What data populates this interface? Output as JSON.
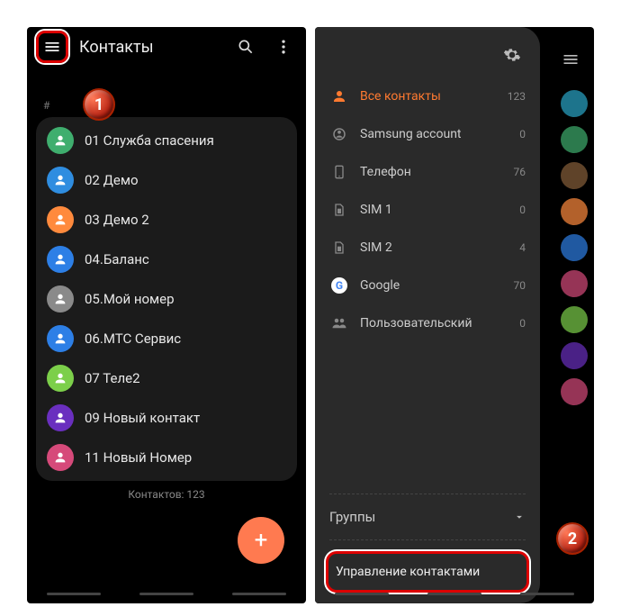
{
  "left": {
    "title": "Контакты",
    "section_index": "#",
    "contacts": [
      {
        "label": "01 Служба спасения",
        "color": "#3fae6e"
      },
      {
        "label": "02 Демо",
        "color": "#2f8de0"
      },
      {
        "label": "03 Демо 2",
        "color": "#ff8a3d"
      },
      {
        "label": "04.Баланс",
        "color": "#2d7fe6"
      },
      {
        "label": "05.Мой номер",
        "color": "#8a8a8a"
      },
      {
        "label": "06.МТС Сервис",
        "color": "#2d7fe6"
      },
      {
        "label": "07 Теле2",
        "color": "#7ccf4a"
      },
      {
        "label": "09 Новый контакт",
        "color": "#6a2fbf"
      },
      {
        "label": "11 Новый Номер",
        "color": "#d64a7a"
      }
    ],
    "count_text": "Контактов: 123",
    "callout": "1"
  },
  "right": {
    "accounts": [
      {
        "icon": "person",
        "label": "Все контакты",
        "count": "123",
        "active": true
      },
      {
        "icon": "samsung",
        "label": "Samsung account",
        "count": "0"
      },
      {
        "icon": "phone",
        "label": "Телефон",
        "count": "76"
      },
      {
        "icon": "sim",
        "label": "SIM 1",
        "count": "0"
      },
      {
        "icon": "sim",
        "label": "SIM 2",
        "count": "4"
      },
      {
        "icon": "google",
        "label": "Google",
        "count": "70"
      },
      {
        "icon": "group",
        "label": "Пользовательский",
        "count": "0"
      }
    ],
    "groups_label": "Группы",
    "manage_label": "Управление контактами",
    "callout": "2",
    "peek_colors": [
      "#2aa5c7",
      "#3fae6e",
      "#875f3a",
      "#ff8a3d",
      "#2d7fe6",
      "#d64a7a",
      "#7ccf4a",
      "#6a2fbf",
      "#d64a7a"
    ]
  }
}
